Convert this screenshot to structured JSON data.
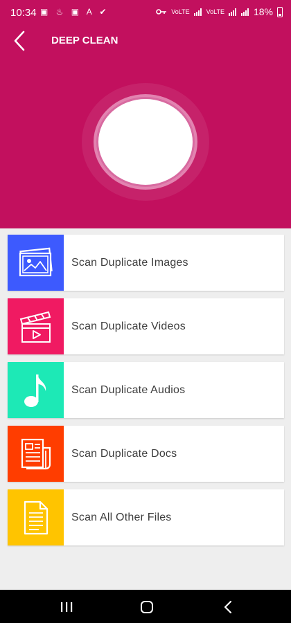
{
  "status_bar": {
    "time": "10:34",
    "icons_left": "▣ ♨ ▣ A ✔",
    "network": "VoLTE",
    "battery": "18%"
  },
  "header": {
    "title": "DEEP CLEAN",
    "background": "#c2105e"
  },
  "menu": [
    {
      "label": "Scan Duplicate Images",
      "icon": "image-icon",
      "color": "#3d5afe"
    },
    {
      "label": "Scan Duplicate Videos",
      "icon": "video-icon",
      "color": "#f01a62"
    },
    {
      "label": "Scan Duplicate Audios",
      "icon": "music-note-icon",
      "color": "#1de9b6"
    },
    {
      "label": "Scan Duplicate Docs",
      "icon": "document-icon",
      "color": "#ff3d00"
    },
    {
      "label": "Scan All Other Files",
      "icon": "file-icon",
      "color": "#ffc400"
    }
  ],
  "nav": [
    "recent-apps-icon",
    "home-icon",
    "back-icon"
  ]
}
